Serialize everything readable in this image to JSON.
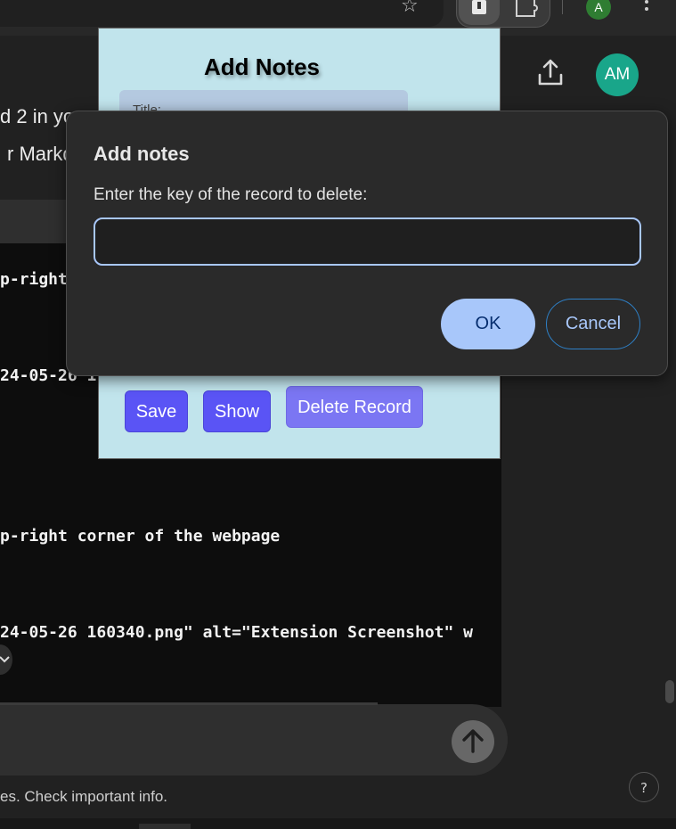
{
  "browser": {
    "profile_initial": "A",
    "icons": [
      "star-icon",
      "extension-active-icon",
      "puzzle-icon",
      "more-vert-icon"
    ]
  },
  "chat": {
    "text_line_1": "d 2 in yo",
    "text_line_2": "r Markd",
    "code_lines": [
      "p-right",
      "24-05-26 1",
      "p-right corner of the webpage",
      "24-05-26 160340.png\" alt=\"Extension Screenshot\" w"
    ],
    "avatar_initials": "AM",
    "footer_text": "es. Check important info.",
    "help_label": "?"
  },
  "popup": {
    "title": "Add Notes",
    "title_field_label": "Title:",
    "buttons": {
      "save": "Save",
      "show": "Show",
      "delete": "Delete Record"
    }
  },
  "dialog": {
    "title": "Add notes",
    "message": "Enter the key of the record to delete:",
    "input_value": "",
    "ok_label": "OK",
    "cancel_label": "Cancel"
  },
  "colors": {
    "popup_bg": "#c1e4ec",
    "primary_button": "#5a54f5",
    "dialog_bg": "#2a2a2a",
    "ok_button": "#a8c7fa",
    "avatar": "#19a68a"
  }
}
